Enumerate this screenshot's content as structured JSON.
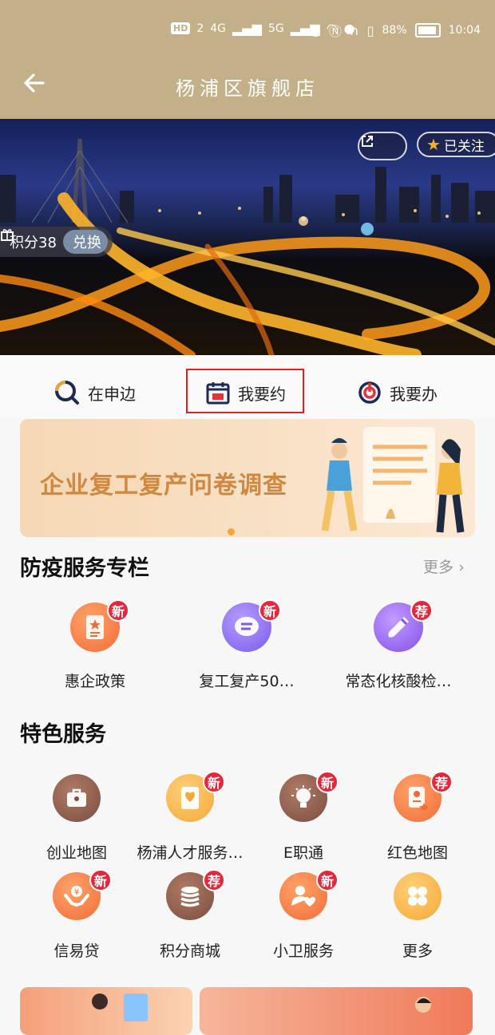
{
  "status_bar": {
    "left": [
      "HD",
      "2",
      "4G",
      "5G"
    ],
    "battery_pct": "88%",
    "time": "10:04"
  },
  "header": {
    "title": "杨浦区旗舰店"
  },
  "banner": {
    "follow_label": "已关注",
    "points_label": "积分38",
    "exchange_label": "兑换"
  },
  "quick_actions": [
    {
      "label": "在申边",
      "icon": "search-magnifier-icon"
    },
    {
      "label": "我要约",
      "icon": "calendar-icon"
    },
    {
      "label": "我要办",
      "icon": "power-icon"
    }
  ],
  "survey_banner": {
    "text": "企业复工复产问卷调查"
  },
  "epidemic": {
    "title": "防疫服务专栏",
    "more": "更多",
    "items": [
      {
        "label": "惠企政策",
        "badge": "新",
        "icon": "policy-doc-icon",
        "color": "#f7743a"
      },
      {
        "label": "复工复产50…",
        "badge": "新",
        "icon": "chat-bubble-icon",
        "color": "#8b6cf0"
      },
      {
        "label": "常态化核酸检…",
        "badge": "荐",
        "icon": "test-tube-icon",
        "color": "#8f5ef0"
      }
    ]
  },
  "featured": {
    "title": "特色服务",
    "items": [
      {
        "label": "创业地图",
        "badge": "",
        "icon": "briefcase-icon",
        "color": "#8a5d4c"
      },
      {
        "label": "杨浦人才服务…",
        "badge": "新",
        "icon": "talent-doc-icon",
        "color": "#f6b24a"
      },
      {
        "label": "E职通",
        "badge": "新",
        "icon": "lightbulb-icon",
        "color": "#8a5d4c"
      },
      {
        "label": "红色地图",
        "badge": "荐",
        "icon": "certificate-icon",
        "color": "#f7743a"
      },
      {
        "label": "信易贷",
        "badge": "新",
        "icon": "hands-coin-icon",
        "color": "#f7743a"
      },
      {
        "label": "积分商城",
        "badge": "荐",
        "icon": "coin-stack-icon",
        "color": "#8a5d4c"
      },
      {
        "label": "小卫服务",
        "badge": "新",
        "icon": "heart-user-icon",
        "color": "#f7743a"
      },
      {
        "label": "更多",
        "badge": "",
        "icon": "grid-more-icon",
        "color": "#f6b24a"
      }
    ]
  }
}
